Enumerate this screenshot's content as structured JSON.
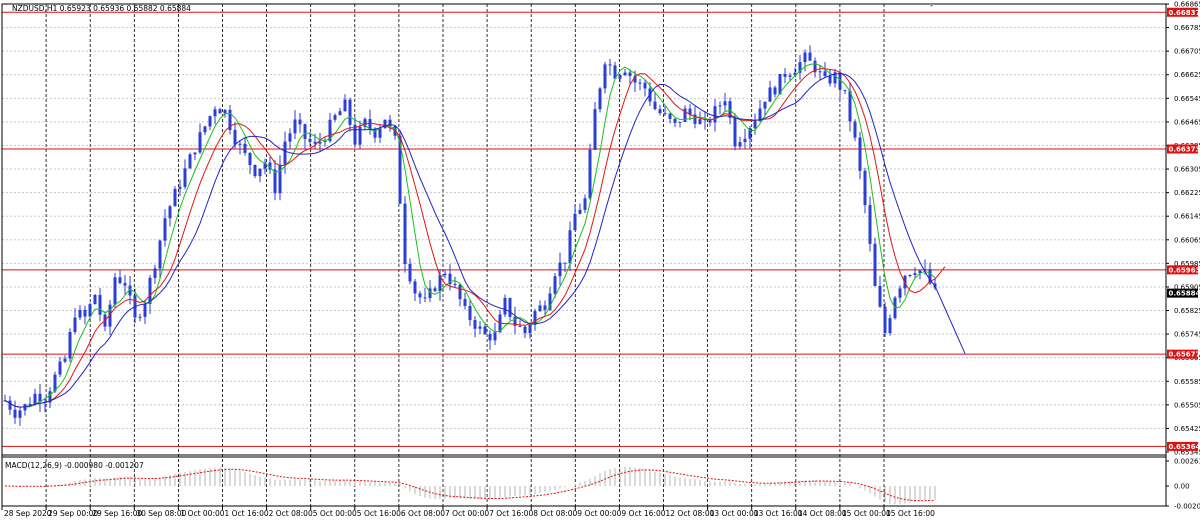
{
  "header": {
    "symbol_line": "NZDUSD,H1  0.65923 0.65936 0.65882 0.65884",
    "macd_line": "MACD(12,26,9) -0.000980 -0.001207"
  },
  "colors": {
    "candle": "#2b3ed6",
    "ma_fast": "#19c219",
    "ma_mid": "#e01616",
    "ma_slow": "#2424c8",
    "level": "#e01010",
    "macd_hist": "#b4b4b4",
    "macd_signal": "#e01010",
    "price_tag": "#000000",
    "level_tag": "#e01010"
  },
  "chart_data": [
    {
      "type": "candlestick",
      "name": "NZDUSD,H1",
      "ylim": [
        0.65345,
        0.66865
      ],
      "y_ticks": [
        "0.66865",
        "0.66785",
        "0.66705",
        "0.66625",
        "0.66545",
        "0.66465",
        "0.66385",
        "0.66305",
        "0.66225",
        "0.66145",
        "0.66065",
        "0.65985",
        "0.65905",
        "0.65825",
        "0.65745",
        "0.65665",
        "0.65585",
        "0.65505",
        "0.65425",
        "0.65345"
      ],
      "x_ticks": [
        "28 Sep 2020",
        "29 Sep 00:00",
        "29 Sep 16:00",
        "30 Sep 08:00",
        "1 Oct 00:00",
        "1 Oct 16:00",
        "2 Oct 08:00",
        "5 Oct 00:00",
        "5 Oct 16:00",
        "6 Oct 08:00",
        "7 Oct 00:00",
        "7 Oct 16:00",
        "8 Oct 08:00",
        "9 Oct 00:00",
        "9 Oct 16:00",
        "12 Oct 08:00",
        "13 Oct 00:00",
        "13 Oct 16:00",
        "14 Oct 08:00",
        "15 Oct 00:00",
        "15 Oct 16:00"
      ],
      "price_levels": [
        {
          "value": 0.66837,
          "label": "0.66837"
        },
        {
          "value": 0.66373,
          "label": "0.66373"
        },
        {
          "value": 0.65963,
          "label": "0.65963"
        },
        {
          "value": 0.65677,
          "label": "0.65677"
        },
        {
          "value": 0.65364,
          "label": "0.65364"
        }
      ],
      "last_price": {
        "value": 0.65884,
        "label": "0.65884"
      },
      "close_path": [
        [
          0,
          0.6552
        ],
        [
          2,
          0.6548
        ],
        [
          4,
          0.655
        ],
        [
          6,
          0.6554
        ],
        [
          8,
          0.6553
        ],
        [
          10,
          0.656
        ],
        [
          12,
          0.6566
        ],
        [
          14,
          0.6582
        ],
        [
          16,
          0.658
        ],
        [
          18,
          0.6588
        ],
        [
          20,
          0.6575
        ],
        [
          22,
          0.6594
        ],
        [
          24,
          0.6592
        ],
        [
          26,
          0.6579
        ],
        [
          28,
          0.6586
        ],
        [
          30,
          0.6599
        ],
        [
          32,
          0.6614
        ],
        [
          34,
          0.6622
        ],
        [
          36,
          0.663
        ],
        [
          38,
          0.6638
        ],
        [
          40,
          0.6645
        ],
        [
          42,
          0.6652
        ],
        [
          44,
          0.665
        ],
        [
          46,
          0.6641
        ],
        [
          48,
          0.6635
        ],
        [
          50,
          0.663
        ],
        [
          52,
          0.6633
        ],
        [
          54,
          0.6624
        ],
        [
          56,
          0.664
        ],
        [
          58,
          0.6646
        ],
        [
          60,
          0.6641
        ],
        [
          62,
          0.6638
        ],
        [
          64,
          0.6642
        ],
        [
          66,
          0.6648
        ],
        [
          68,
          0.6652
        ],
        [
          70,
          0.664
        ],
        [
          72,
          0.6646
        ],
        [
          74,
          0.6643
        ],
        [
          76,
          0.6648
        ],
        [
          78,
          0.664
        ],
        [
          80,
          0.66
        ],
        [
          82,
          0.6589
        ],
        [
          84,
          0.6585
        ],
        [
          86,
          0.6591
        ],
        [
          88,
          0.6596
        ],
        [
          90,
          0.659
        ],
        [
          92,
          0.6582
        ],
        [
          94,
          0.6578
        ],
        [
          96,
          0.6574
        ],
        [
          98,
          0.6574
        ],
        [
          100,
          0.6585
        ],
        [
          102,
          0.6578
        ],
        [
          104,
          0.6575
        ],
        [
          106,
          0.6582
        ],
        [
          108,
          0.6585
        ],
        [
          110,
          0.6596
        ],
        [
          112,
          0.66
        ],
        [
          114,
          0.6615
        ],
        [
          116,
          0.662
        ],
        [
          118,
          0.665
        ],
        [
          120,
          0.6668
        ],
        [
          122,
          0.6663
        ],
        [
          124,
          0.6665
        ],
        [
          126,
          0.666
        ],
        [
          128,
          0.6658
        ],
        [
          130,
          0.6651
        ],
        [
          132,
          0.6648
        ],
        [
          134,
          0.6645
        ],
        [
          136,
          0.665
        ],
        [
          138,
          0.6648
        ],
        [
          140,
          0.6645
        ],
        [
          142,
          0.665
        ],
        [
          144,
          0.6655
        ],
        [
          146,
          0.664
        ],
        [
          148,
          0.6643
        ],
        [
          150,
          0.6648
        ],
        [
          152,
          0.6655
        ],
        [
          154,
          0.6658
        ],
        [
          156,
          0.6663
        ],
        [
          158,
          0.6665
        ],
        [
          160,
          0.6668
        ],
        [
          162,
          0.6665
        ],
        [
          164,
          0.666
        ],
        [
          166,
          0.6662
        ],
        [
          168,
          0.6655
        ],
        [
          170,
          0.664
        ],
        [
          172,
          0.6618
        ],
        [
          174,
          0.659
        ],
        [
          176,
          0.6575
        ],
        [
          178,
          0.6588
        ],
        [
          180,
          0.6595
        ],
        [
          182,
          0.6597
        ],
        [
          184,
          0.6595
        ],
        [
          186,
          0.65884
        ]
      ]
    },
    {
      "type": "macd",
      "name": "MACD(12,26,9)",
      "main": -0.00098,
      "signal": -0.001207,
      "ylim": [
        -0.00208,
        0.00261
      ],
      "y_ticks": [
        "0.00261",
        "0.00",
        "-0.00208"
      ]
    }
  ]
}
